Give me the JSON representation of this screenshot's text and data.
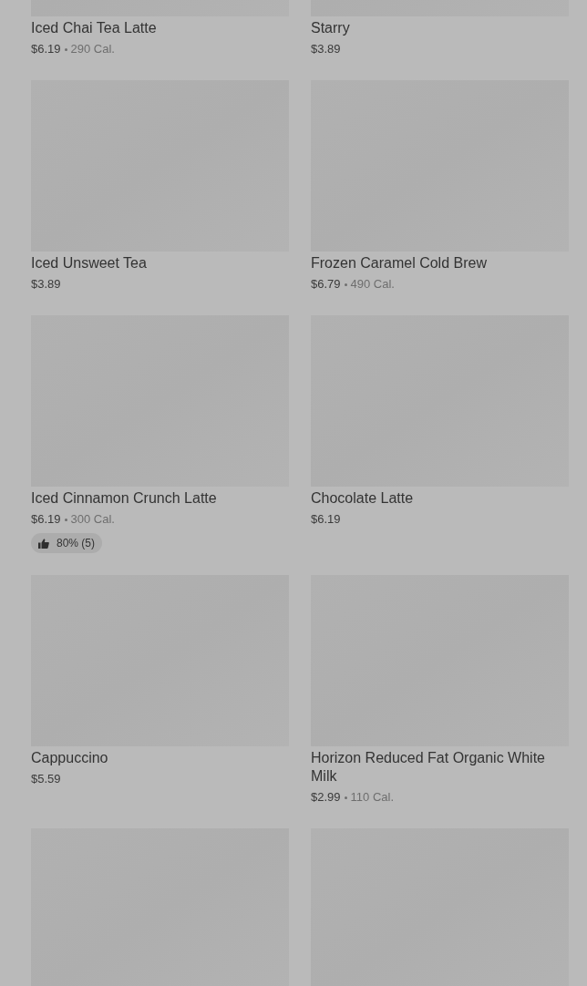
{
  "items": [
    {
      "kind": "item",
      "name": "Iced Chai Tea Latte",
      "price": "$6.19",
      "calories": "290 Cal."
    },
    {
      "kind": "item",
      "name": "Starry",
      "price": "$3.89"
    },
    {
      "kind": "item",
      "name": "Iced Unsweet Tea",
      "price": "$3.89"
    },
    {
      "kind": "item",
      "name": "Frozen Caramel Cold Brew",
      "price": "$6.79",
      "calories": "490 Cal."
    },
    {
      "kind": "item",
      "name": "Iced Cinnamon Crunch Latte",
      "price": "$6.19",
      "calories": "300 Cal.",
      "rating": "80% (5)"
    },
    {
      "kind": "item",
      "name": "Chocolate Latte",
      "price": "$6.19"
    },
    {
      "kind": "item",
      "name": "Cappuccino",
      "price": "$5.59"
    },
    {
      "kind": "item",
      "name": "Horizon Reduced Fat Organic White Milk",
      "price": "$2.99",
      "calories": "110 Cal."
    },
    {
      "kind": "image_only"
    },
    {
      "kind": "image_only"
    }
  ]
}
